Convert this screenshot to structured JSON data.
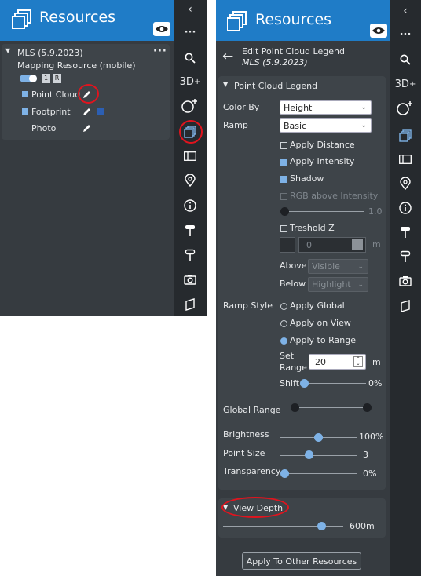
{
  "left": {
    "title": "Resources",
    "resource": {
      "name": "MLS (5.9.2023)",
      "subtitle": "Mapping Resource (mobile)",
      "badges": [
        "1",
        "R"
      ],
      "layers": [
        {
          "label": "Point Cloud",
          "checked": true
        },
        {
          "label": "Footprint",
          "checked": true
        },
        {
          "label": "Photo",
          "checked": false
        }
      ]
    },
    "menu_icon": "more-icon"
  },
  "right": {
    "title": "Resources",
    "edit_title": "Edit Point Cloud Legend",
    "edit_subtitle": "MLS (5.9.2023)",
    "legend_section": "Point Cloud Legend",
    "color_by_label": "Color By",
    "color_by_value": "Height",
    "ramp_label": "Ramp",
    "ramp_value": "Basic",
    "apply_distance": "Apply Distance",
    "apply_intensity": "Apply Intensity",
    "shadow": "Shadow",
    "rgb_above_intensity": "RGB above Intensity",
    "rgb_slider_value": "1.0",
    "treshold_z": "Treshold Z",
    "treshold_value": "0",
    "treshold_unit": "m",
    "above_label": "Above",
    "above_value": "Visible",
    "below_label": "Below",
    "below_value": "Highlight",
    "ramp_style_label": "Ramp Style",
    "ramp_style_options": [
      "Apply Global",
      "Apply on View",
      "Apply to Range"
    ],
    "ramp_style_selected": "Apply to Range",
    "set_range_label_1": "Set",
    "set_range_label_2": "Range",
    "set_range_value": "20",
    "set_range_unit": "m",
    "shift_label": "Shift",
    "shift_value": "0%",
    "global_range_label": "Global Range",
    "brightness_label": "Brightness",
    "brightness_value": "100%",
    "point_size_label": "Point Size",
    "point_size_value": "3",
    "transparency_label": "Transparency",
    "transparency_value": "0%",
    "view_depth_label": "View Depth",
    "view_depth_value": "600m",
    "apply_button": "Apply To Other Resources"
  },
  "rail": {
    "top_labels": [
      "3D",
      "+"
    ]
  },
  "colors": {
    "header": "#1f7cc7",
    "panel": "#363b40",
    "rail": "#262a2e",
    "accent": "#7eb2e6",
    "annotation": "#e0141e"
  }
}
